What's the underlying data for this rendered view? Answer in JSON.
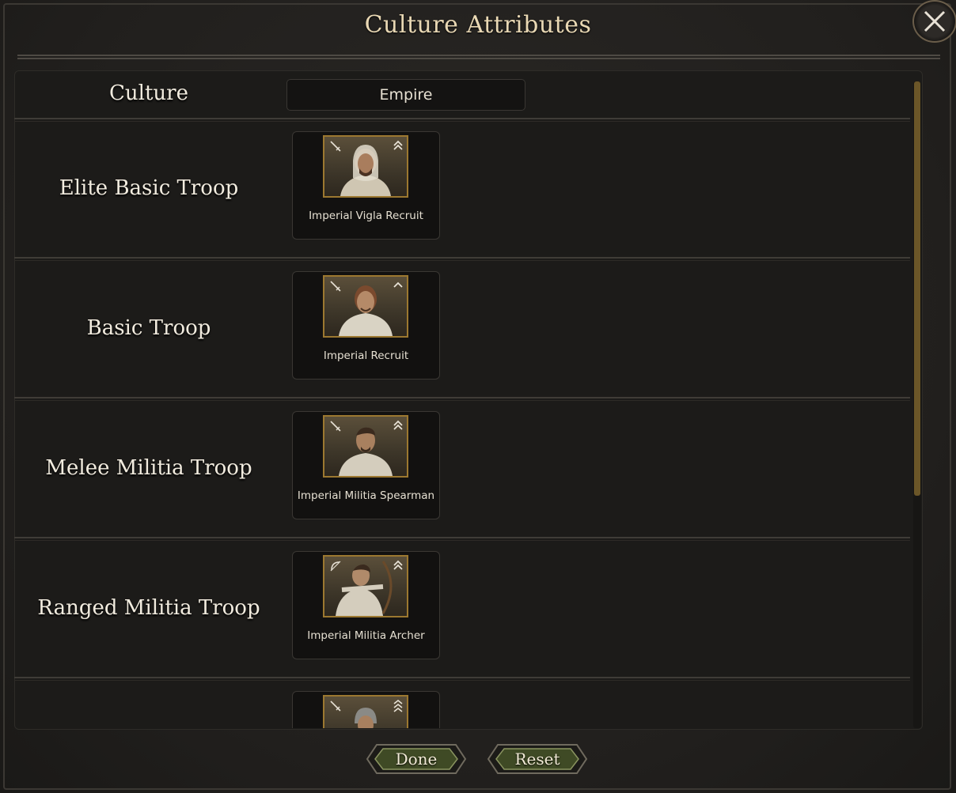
{
  "window": {
    "title": "Culture Attributes"
  },
  "culture_row": {
    "label": "Culture",
    "value": "Empire"
  },
  "rows": [
    {
      "label": "Elite Basic Troop",
      "troop": "Imperial Vigla Recruit",
      "type_icon": "sword-icon",
      "tier_icon": "double-chevron-icon"
    },
    {
      "label": "Basic Troop",
      "troop": "Imperial Recruit",
      "type_icon": "sword-icon",
      "tier_icon": "single-chevron-icon"
    },
    {
      "label": "Melee Militia Troop",
      "troop": "Imperial Militia Spearman",
      "type_icon": "sword-icon",
      "tier_icon": "double-chevron-icon"
    },
    {
      "label": "Ranged Militia Troop",
      "troop": "Imperial Militia Archer",
      "type_icon": "bow-icon",
      "tier_icon": "double-chevron-icon"
    },
    {
      "label": "",
      "troop": "",
      "type_icon": "sword-icon",
      "tier_icon": "triple-chevron-icon"
    }
  ],
  "buttons": {
    "done": "Done",
    "reset": "Reset"
  },
  "colors": {
    "gold_accent": "#9c7830",
    "scroll_thumb": "#6b5628",
    "title_text": "#e9d8b4"
  }
}
